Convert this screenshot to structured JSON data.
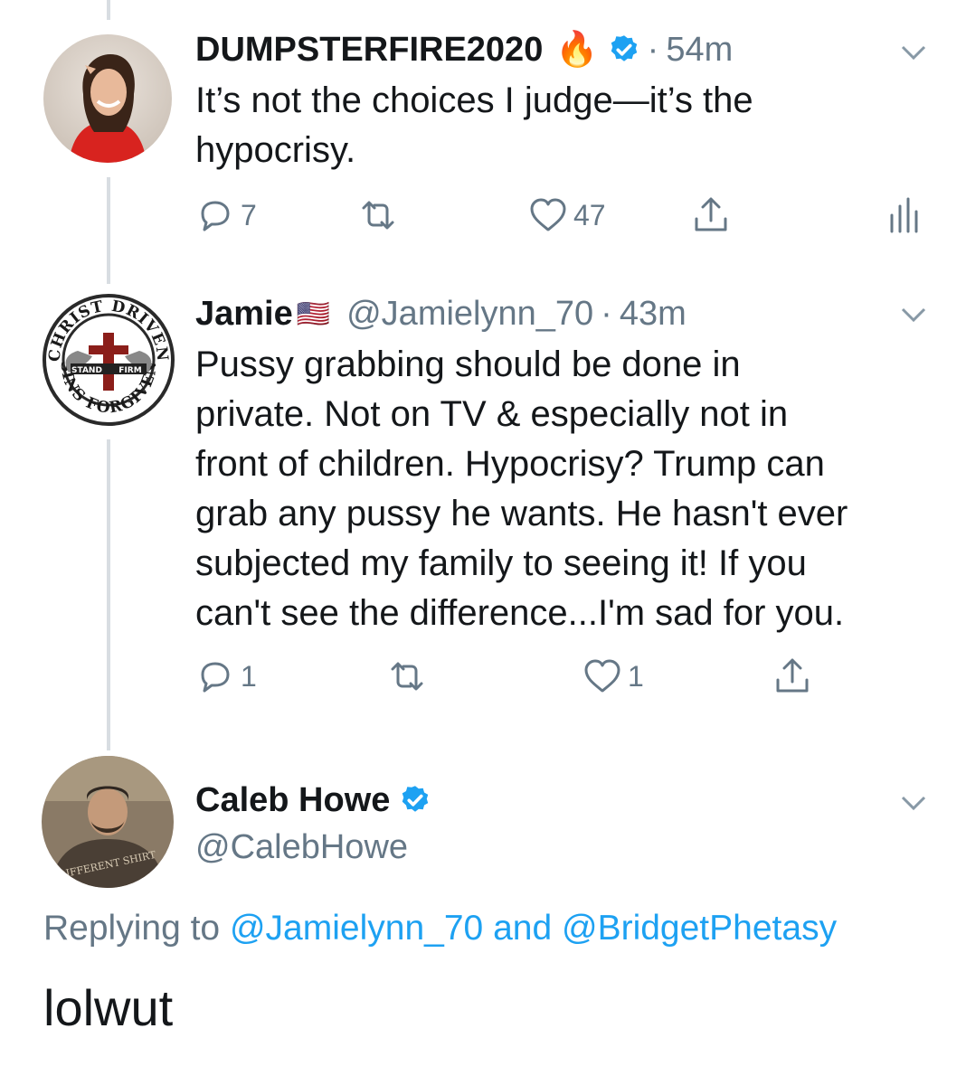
{
  "tweets": [
    {
      "display_name": "DUMPSTERFIRE2020",
      "emoji": "🔥",
      "verified": true,
      "separator": "·",
      "time": "54m",
      "text_lines": [
        "It’s not the choices I judge—it’s the",
        "hypocrisy."
      ],
      "replies": "7",
      "likes": "47"
    },
    {
      "display_name": "Jamie",
      "flag_emoji": "🇺🇸",
      "handle": "@Jamielynn_70",
      "separator": "·",
      "time": "43m",
      "text_lines": [
        "Pussy grabbing should be done in",
        "private. Not on TV & especially not in",
        "front of children. Hypocrisy? Trump can",
        "grab any pussy he wants. He hasn't ever",
        "subjected my family to seeing it! If you",
        "can't see the difference...I'm sad for you."
      ],
      "replies": "1",
      "likes": "1",
      "avatar_text": {
        "top": "CHRIST DRIVEN",
        "bottom": "SINS FORGIVEN",
        "left": "STAND",
        "right": "FIRM"
      }
    }
  ],
  "focused": {
    "display_name": "Caleb Howe",
    "handle": "@CalebHowe",
    "replying_prefix": "Replying to",
    "mention1": "@Jamielynn_70",
    "conjunction": "and",
    "mention2": "@BridgetPhetasy",
    "text": "lolwut",
    "avatar_shirt_text": "DIFFERENT SHIRT"
  },
  "colors": {
    "accent": "#1da1f2",
    "secondary_text": "#657786",
    "thread_line": "#d8dde2"
  },
  "icons": [
    "reply-icon",
    "retweet-icon",
    "like-icon",
    "share-icon",
    "analytics-icon",
    "chevron-down-icon",
    "verified-badge-icon",
    "fire-emoji",
    "us-flag-emoji"
  ]
}
